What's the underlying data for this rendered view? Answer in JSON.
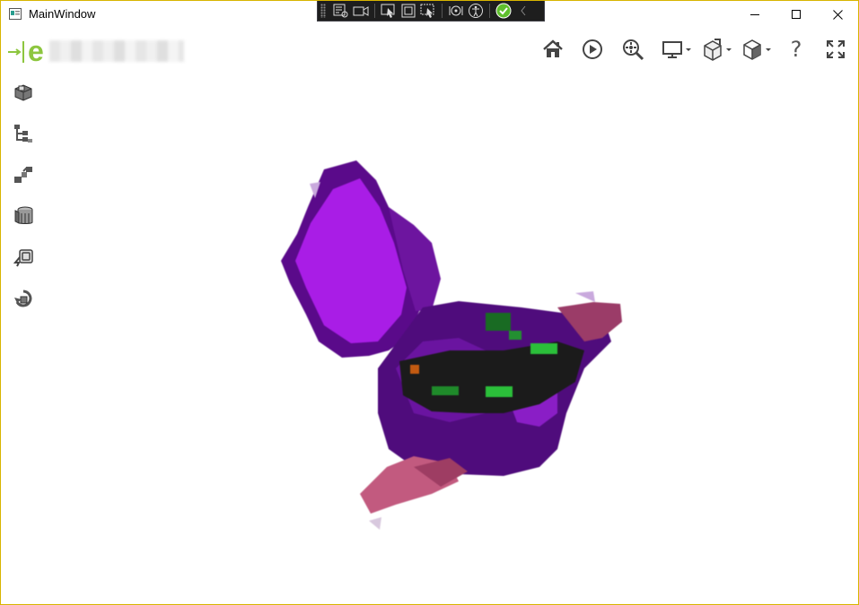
{
  "window": {
    "title": "MainWindow",
    "controls": {
      "minimize_icon": "minimize-icon",
      "maximize_icon": "maximize-icon",
      "close_icon": "close-icon"
    },
    "border_color": "#d8b500"
  },
  "debug_toolbar": {
    "items": [
      "select-element-icon",
      "record-icon",
      "select-pointer-icon",
      "display-layout-icon",
      "track-focus-icon",
      "hot-reload-icon",
      "accessibility-icon",
      "binding-ok-icon",
      "collapse-icon"
    ]
  },
  "logo": {
    "letter": "e",
    "accent_color": "#8dc63f"
  },
  "sidebar": {
    "items": [
      {
        "name": "parts-icon"
      },
      {
        "name": "tree-structure-icon"
      },
      {
        "name": "steps-icon"
      },
      {
        "name": "layers-icon"
      },
      {
        "name": "camera-icon"
      },
      {
        "name": "reset-icon"
      }
    ]
  },
  "toolbar": {
    "items": [
      {
        "name": "home-icon"
      },
      {
        "name": "play-icon"
      },
      {
        "name": "zoom-fit-icon"
      },
      {
        "name": "display-mode-icon"
      },
      {
        "name": "view-orientation-icon"
      },
      {
        "name": "render-style-icon"
      },
      {
        "name": "help-icon"
      },
      {
        "name": "fullscreen-icon"
      }
    ],
    "help_label": "?"
  },
  "viewport": {
    "content": "pixelated-3d-model",
    "colors": {
      "violet": "#a91de6",
      "purple": "#5e0f8f",
      "dark": "#1b1b1b",
      "green": "#2bbf3a",
      "pink": "#c25a7f"
    }
  }
}
